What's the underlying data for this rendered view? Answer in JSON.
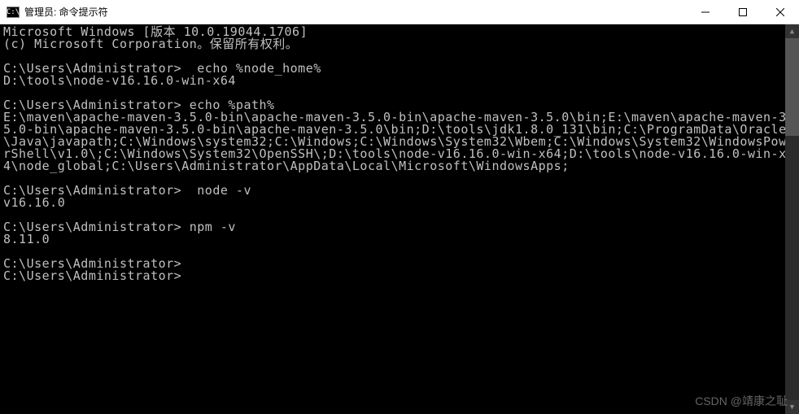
{
  "titlebar": {
    "icon_text": "C:\\",
    "title": "管理员: 命令提示符"
  },
  "terminal": {
    "lines": [
      "Microsoft Windows [版本 10.0.19044.1706]",
      "(c) Microsoft Corporation。保留所有权利。",
      "",
      "C:\\Users\\Administrator>  echo %node_home%",
      "D:\\tools\\node-v16.16.0-win-x64",
      "",
      "C:\\Users\\Administrator> echo %path%",
      "E:\\maven\\apache-maven-3.5.0-bin\\apache-maven-3.5.0-bin\\apache-maven-3.5.0\\bin;E:\\maven\\apache-maven-3.5.0-bin\\apache-maven-3.5.0-bin\\apache-maven-3.5.0\\bin;D:\\tools\\jdk1.8.0_131\\bin;C:\\ProgramData\\Oracle\\Java\\javapath;C:\\Windows\\system32;C:\\Windows;C:\\Windows\\System32\\Wbem;C:\\Windows\\System32\\WindowsPowerShell\\v1.0\\;C:\\Windows\\System32\\OpenSSH\\;D:\\tools\\node-v16.16.0-win-x64;D:\\tools\\node-v16.16.0-win-x64\\node_global;C:\\Users\\Administrator\\AppData\\Local\\Microsoft\\WindowsApps;",
      "",
      "C:\\Users\\Administrator>  node -v",
      "v16.16.0",
      "",
      "C:\\Users\\Administrator> npm -v",
      "8.11.0",
      "",
      "C:\\Users\\Administrator>",
      "C:\\Users\\Administrator>"
    ]
  },
  "watermark": "CSDN @靖康之耻"
}
